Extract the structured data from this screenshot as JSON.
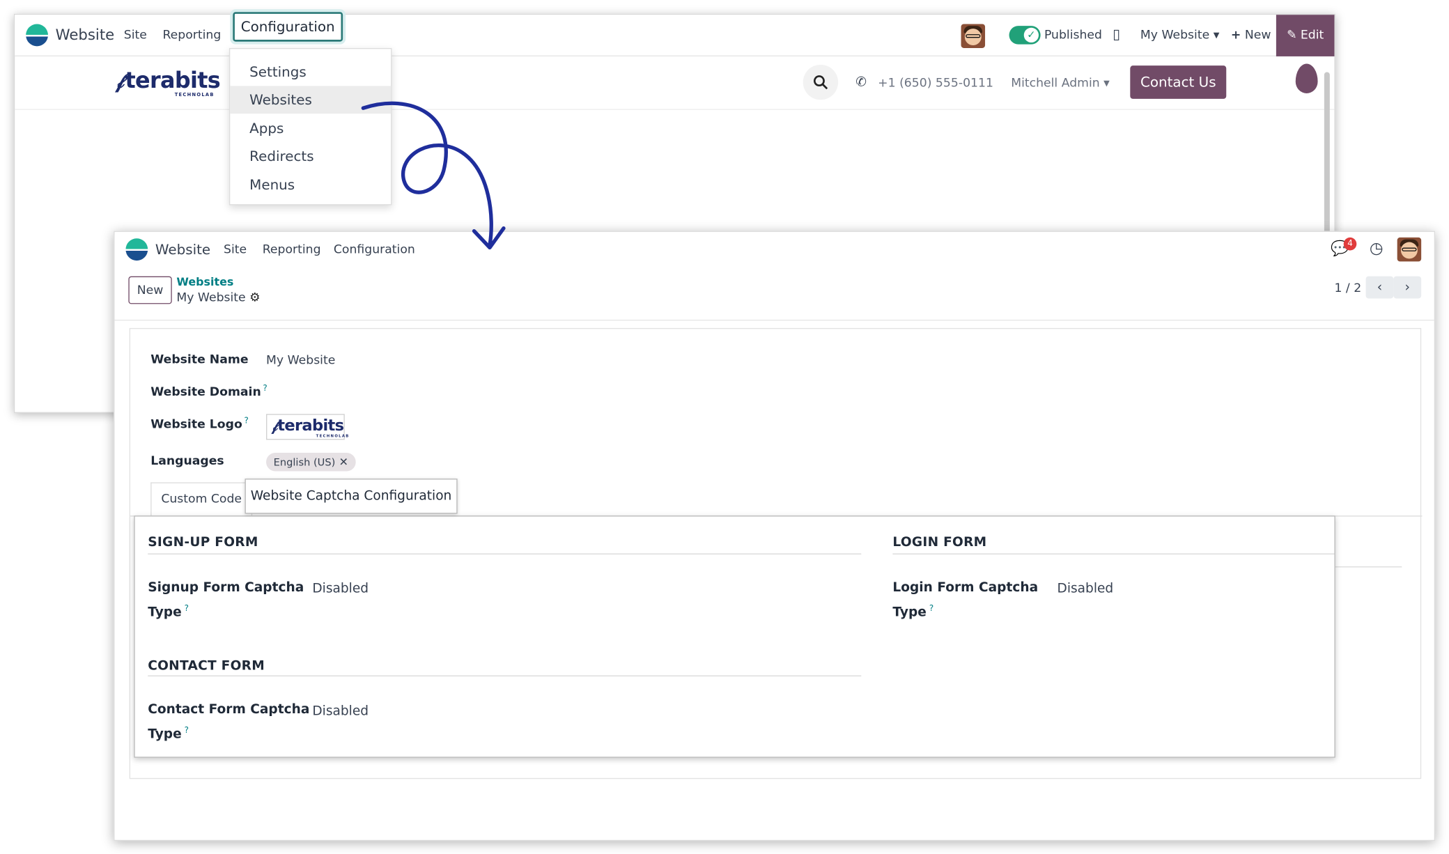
{
  "top_window": {
    "nav": {
      "brand": "Website",
      "menus": [
        "Site",
        "Reporting",
        "Configuration"
      ],
      "published_label": "Published",
      "website_selector": "My Website",
      "new_label": "New",
      "edit_label": "Edit"
    },
    "site_header": {
      "logo_text": "terabits",
      "logo_subtext": "TECHNOLAB",
      "phone": "+1 (650) 555-0111",
      "user": "Mitchell Admin",
      "contact_button": "Contact Us"
    },
    "configuration_menu": {
      "items": [
        "Settings",
        "Websites",
        "Apps",
        "Redirects",
        "Menus"
      ],
      "active": "Websites"
    }
  },
  "form_window": {
    "nav": {
      "brand": "Website",
      "menus": [
        "Site",
        "Reporting",
        "Configuration"
      ],
      "chat_badge_count": "4"
    },
    "control_panel": {
      "new_label": "New",
      "breadcrumb_parent": "Websites",
      "breadcrumb_current": "My Website",
      "pager": "1 / 2"
    },
    "fields": {
      "website_name_label": "Website Name",
      "website_name_value": "My Website",
      "website_domain_label": "Website Domain",
      "website_logo_label": "Website Logo",
      "languages_label": "Languages",
      "language_tag": "English (US)",
      "help_mark": "?"
    },
    "tabs": {
      "custom_code": "Custom Code",
      "captcha": "Website Captcha Configuration"
    },
    "captcha": {
      "signup_title": "SIGN-UP FORM",
      "signup_label_line1": "Signup Form Captcha",
      "signup_label_line2": "Type",
      "signup_value": "Disabled",
      "login_title": "LOGIN FORM",
      "login_label_line1": "Login Form Captcha",
      "login_label_line2": "Type",
      "login_value": "Disabled",
      "contact_title": "CONTACT FORM",
      "contact_label_line1": "Contact Form Captcha",
      "contact_label_line2": "Type",
      "contact_value": "Disabled"
    }
  },
  "colors": {
    "brand_purple": "#714b67",
    "teal_link": "#017e84",
    "toggle_green": "#21a179",
    "arrow_blue": "#1f2e9c"
  }
}
